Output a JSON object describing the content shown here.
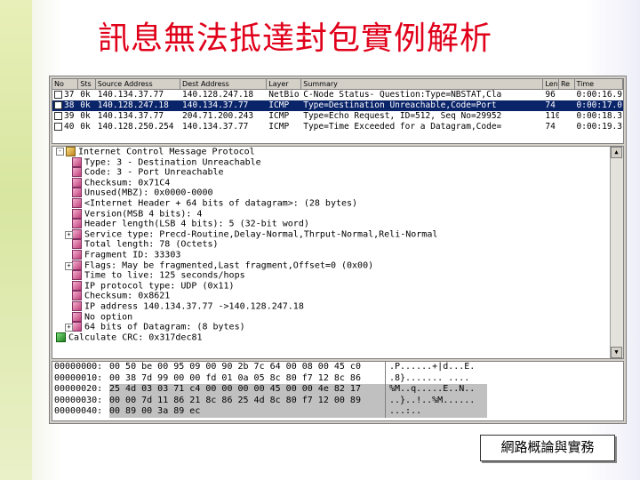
{
  "slide": {
    "title": "訊息無法抵達封包實例解析",
    "footer": "網路概論與實務"
  },
  "packet_list": {
    "columns": [
      "No",
      "Sts",
      "Source Address",
      "Dest Address",
      "Layer",
      "Summary",
      "Len",
      "Re",
      "Time"
    ],
    "rows": [
      {
        "no": "37",
        "sts": "0k",
        "src": "140.134.37.77",
        "dst": "140.128.247.18",
        "layer": "NetBio",
        "summary": "C-Node Status- Question:Type=NBSTAT,Cla",
        "len": "96",
        "time": "0:00:16.9"
      },
      {
        "no": "38",
        "sts": "0k",
        "src": "140.128.247.18",
        "dst": "140.134.37.77",
        "layer": "ICMP",
        "summary": "Type=Destination Unreachable,Code=Port",
        "len": "74",
        "time": "0:00:17.0"
      },
      {
        "no": "39",
        "sts": "0k",
        "src": "140.134.37.77",
        "dst": "204.71.200.243",
        "layer": "ICMP",
        "summary": "Type=Echo Request, ID=512, Seq No=29952",
        "len": "110",
        "time": "0:00:18.3"
      },
      {
        "no": "40",
        "sts": "0k",
        "src": "140.128.250.254",
        "dst": "140.134.37.77",
        "layer": "ICMP",
        "summary": "Type=Time Exceeded for a Datagram,Code=",
        "len": "74",
        "time": "0:00:19.3"
      }
    ]
  },
  "tree": {
    "items": [
      {
        "text": "Internet Control Message Protocol",
        "level": 0,
        "icon": "protocol-root-icon",
        "exp": "-"
      },
      {
        "text": "Type: 3 - Destination Unreachable",
        "level": 1,
        "icon": "field-icon"
      },
      {
        "text": "Code: 3 - Port Unreachable",
        "level": 1,
        "icon": "field-icon"
      },
      {
        "text": "Checksum: 0x71C4",
        "level": 1,
        "icon": "field-icon"
      },
      {
        "text": "Unused(MBZ): 0x0000-0000",
        "level": 1,
        "icon": "field-icon"
      },
      {
        "text": "<Internet Header + 64 bits of datagram>: (28 bytes)",
        "level": 1,
        "icon": "field-icon"
      },
      {
        "text": "Version(MSB 4 bits): 4",
        "level": 1,
        "icon": "field-icon"
      },
      {
        "text": "Header length(LSB 4 bits): 5 (32-bit word)",
        "level": 1,
        "icon": "field-icon"
      },
      {
        "text": "Service type: Precd-Routine,Delay-Normal,Thrput-Normal,Reli-Normal",
        "level": 1,
        "icon": "field-icon",
        "exp": "+"
      },
      {
        "text": "Total length: 78 (Octets)",
        "level": 1,
        "icon": "field-icon"
      },
      {
        "text": "Fragment ID: 33303",
        "level": 1,
        "icon": "field-icon"
      },
      {
        "text": "Flags: May be fragmented,Last fragment,Offset=0 (0x00)",
        "level": 1,
        "icon": "field-icon",
        "exp": "+"
      },
      {
        "text": "Time to live: 125 seconds/hops",
        "level": 1,
        "icon": "field-icon"
      },
      {
        "text": "IP protocol type: UDP (0x11)",
        "level": 1,
        "icon": "field-icon"
      },
      {
        "text": "Checksum: 0x8621",
        "level": 1,
        "icon": "field-icon"
      },
      {
        "text": "IP address 140.134.37.77 ->140.128.247.18",
        "level": 1,
        "icon": "field-icon"
      },
      {
        "text": "No option",
        "level": 1,
        "icon": "field-icon"
      },
      {
        "text": "64 bits of Datagram: (8 bytes)",
        "level": 1,
        "icon": "field-icon",
        "exp": "+"
      },
      {
        "text": "Calculate CRC: 0x317dec81",
        "level": 0,
        "icon": "crc-ok-icon"
      }
    ]
  },
  "hex": {
    "rows": [
      {
        "offset": "00000000:",
        "bytes": "00 50 be 00 95 09 00 90 2b 7c 64 00 08 00 45 c0",
        "ascii": ".P......+|d...E."
      },
      {
        "offset": "00000010:",
        "bytes": "00 38 7d 99 00 00 fd 01 0a 05 8c 80 f7 12 8c 86",
        "ascii": ".8}.......  ...."
      },
      {
        "offset": "00000020:",
        "bytes": "25 4d 03 03 71 c4 00 00 00 00 45 00 00 4e 82 17",
        "ascii": "%M..q.....E..N.."
      },
      {
        "offset": "00000030:",
        "bytes": "00 00 7d 11 86 21 8c 86 25 4d 8c 80 f7 12 00 89",
        "ascii": "..}..!..%M......"
      },
      {
        "offset": "00000040:",
        "bytes": "00 89 00 3a 89 ec",
        "ascii": "...:.."
      }
    ]
  },
  "colors": {
    "title": "#e0001a",
    "selection": "#0a246a"
  }
}
